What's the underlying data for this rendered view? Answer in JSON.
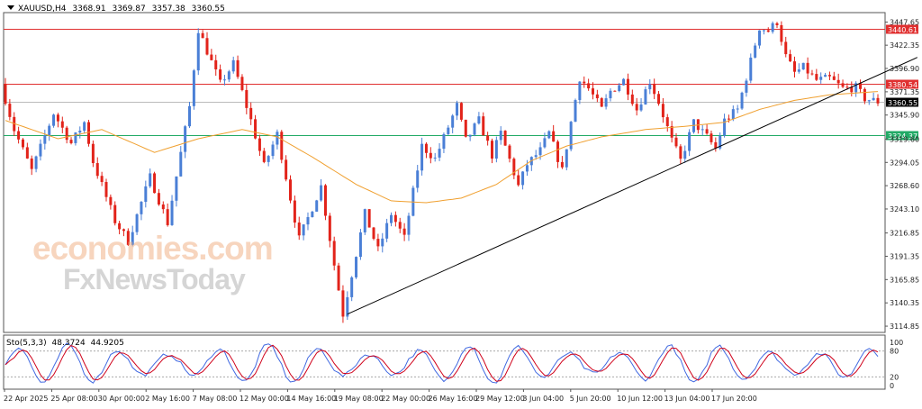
{
  "header": {
    "symbol": "XAUUSD,H4",
    "open": "3368.91",
    "high": "3369.87",
    "low": "3357.38",
    "close": "3360.55"
  },
  "stochastic": {
    "label": "Sto(5,3,3)",
    "main": "48.3724",
    "signal": "44.9205",
    "levels": [
      "100",
      "80",
      "20",
      "0"
    ],
    "colors": {
      "main": "#4169e1",
      "signal": "#d0021b"
    }
  },
  "watermark": {
    "line1": "economies.com",
    "line2": "FxNewsToday"
  },
  "chart_data": {
    "type": "candlestick",
    "price_axis": {
      "range": [
        3108,
        3458
      ],
      "ticks": [
        "3447.65",
        "3422.35",
        "3396.90",
        "3371.35",
        "3345.90",
        "3319.60",
        "3294.05",
        "3268.60",
        "3243.10",
        "3216.85",
        "3191.35",
        "3165.85",
        "3140.35",
        "3114.85"
      ]
    },
    "time_axis": {
      "ticks": [
        "22 Apr 2025",
        "25 Apr 08:00",
        "30 Apr 00:00",
        "2 May 16:00",
        "7 May 08:00",
        "12 May 00:00",
        "14 May 16:00",
        "19 May 08:00",
        "22 May 00:00",
        "26 May 16:00",
        "29 May 12:00",
        "3 Jun 04:00",
        "5 Jun 20:00",
        "10 Jun 12:00",
        "13 Jun 04:00",
        "17 Jun 20:00"
      ]
    },
    "levels": [
      {
        "label": "3440.61",
        "value": 3440.61,
        "color": "#e03030"
      },
      {
        "label": "3380.54",
        "value": 3380.54,
        "color": "#e03030"
      },
      {
        "label": "3360.55",
        "value": 3360.55,
        "color": "#000000"
      },
      {
        "label": "3324.37",
        "value": 3324.37,
        "color": "#22aa66"
      }
    ],
    "colors": {
      "up": "#4a7fd6",
      "down": "#e2231a",
      "ma": "#f0a030",
      "trend": "#000000"
    },
    "path": [
      [
        0,
        3380
      ],
      [
        3,
        3330
      ],
      [
        7,
        3285
      ],
      [
        12,
        3348
      ],
      [
        16,
        3315
      ],
      [
        19,
        3338
      ],
      [
        21,
        3295
      ],
      [
        26,
        3230
      ],
      [
        29,
        3208
      ],
      [
        34,
        3278
      ],
      [
        38,
        3228
      ],
      [
        43,
        3355
      ],
      [
        45,
        3440
      ],
      [
        50,
        3380
      ],
      [
        53,
        3402
      ],
      [
        57,
        3340
      ],
      [
        60,
        3290
      ],
      [
        63,
        3325
      ],
      [
        66,
        3255
      ],
      [
        68,
        3210
      ],
      [
        73,
        3268
      ],
      [
        76,
        3182
      ],
      [
        78,
        3128
      ],
      [
        83,
        3238
      ],
      [
        86,
        3198
      ],
      [
        89,
        3238
      ],
      [
        92,
        3211
      ],
      [
        96,
        3312
      ],
      [
        99,
        3298
      ],
      [
        104,
        3356
      ],
      [
        106,
        3318
      ],
      [
        109,
        3340
      ],
      [
        112,
        3302
      ],
      [
        114,
        3326
      ],
      [
        118,
        3268
      ],
      [
        120,
        3292
      ],
      [
        123,
        3307
      ],
      [
        125,
        3326
      ],
      [
        128,
        3285
      ],
      [
        130,
        3338
      ],
      [
        132,
        3387
      ],
      [
        134,
        3375
      ],
      [
        137,
        3352
      ],
      [
        139,
        3372
      ],
      [
        142,
        3384
      ],
      [
        145,
        3352
      ],
      [
        148,
        3383
      ],
      [
        150,
        3360
      ],
      [
        153,
        3318
      ],
      [
        155,
        3296
      ],
      [
        158,
        3338
      ],
      [
        161,
        3322
      ],
      [
        163,
        3309
      ],
      [
        165,
        3340
      ],
      [
        168,
        3352
      ],
      [
        171,
        3405
      ],
      [
        173,
        3442
      ],
      [
        175,
        3438
      ],
      [
        177,
        3448
      ],
      [
        179,
        3410
      ],
      [
        181,
        3392
      ],
      [
        183,
        3398
      ],
      [
        186,
        3384
      ],
      [
        189,
        3386
      ],
      [
        192,
        3375
      ],
      [
        195,
        3376
      ],
      [
        197,
        3364
      ],
      [
        200,
        3360.55
      ]
    ],
    "ma_values": [
      [
        0,
        3340
      ],
      [
        12,
        3320
      ],
      [
        22,
        3330
      ],
      [
        34,
        3305
      ],
      [
        44,
        3320
      ],
      [
        54,
        3330
      ],
      [
        62,
        3322
      ],
      [
        70,
        3300
      ],
      [
        80,
        3270
      ],
      [
        88,
        3252
      ],
      [
        96,
        3250
      ],
      [
        104,
        3255
      ],
      [
        112,
        3270
      ],
      [
        120,
        3296
      ],
      [
        128,
        3312
      ],
      [
        136,
        3322
      ],
      [
        146,
        3330
      ],
      [
        156,
        3334
      ],
      [
        164,
        3338
      ],
      [
        172,
        3352
      ],
      [
        180,
        3362
      ],
      [
        188,
        3368
      ],
      [
        194,
        3370
      ],
      [
        200,
        3372
      ]
    ],
    "trendline": [
      [
        78,
        3128
      ],
      [
        208,
        3409
      ]
    ]
  }
}
